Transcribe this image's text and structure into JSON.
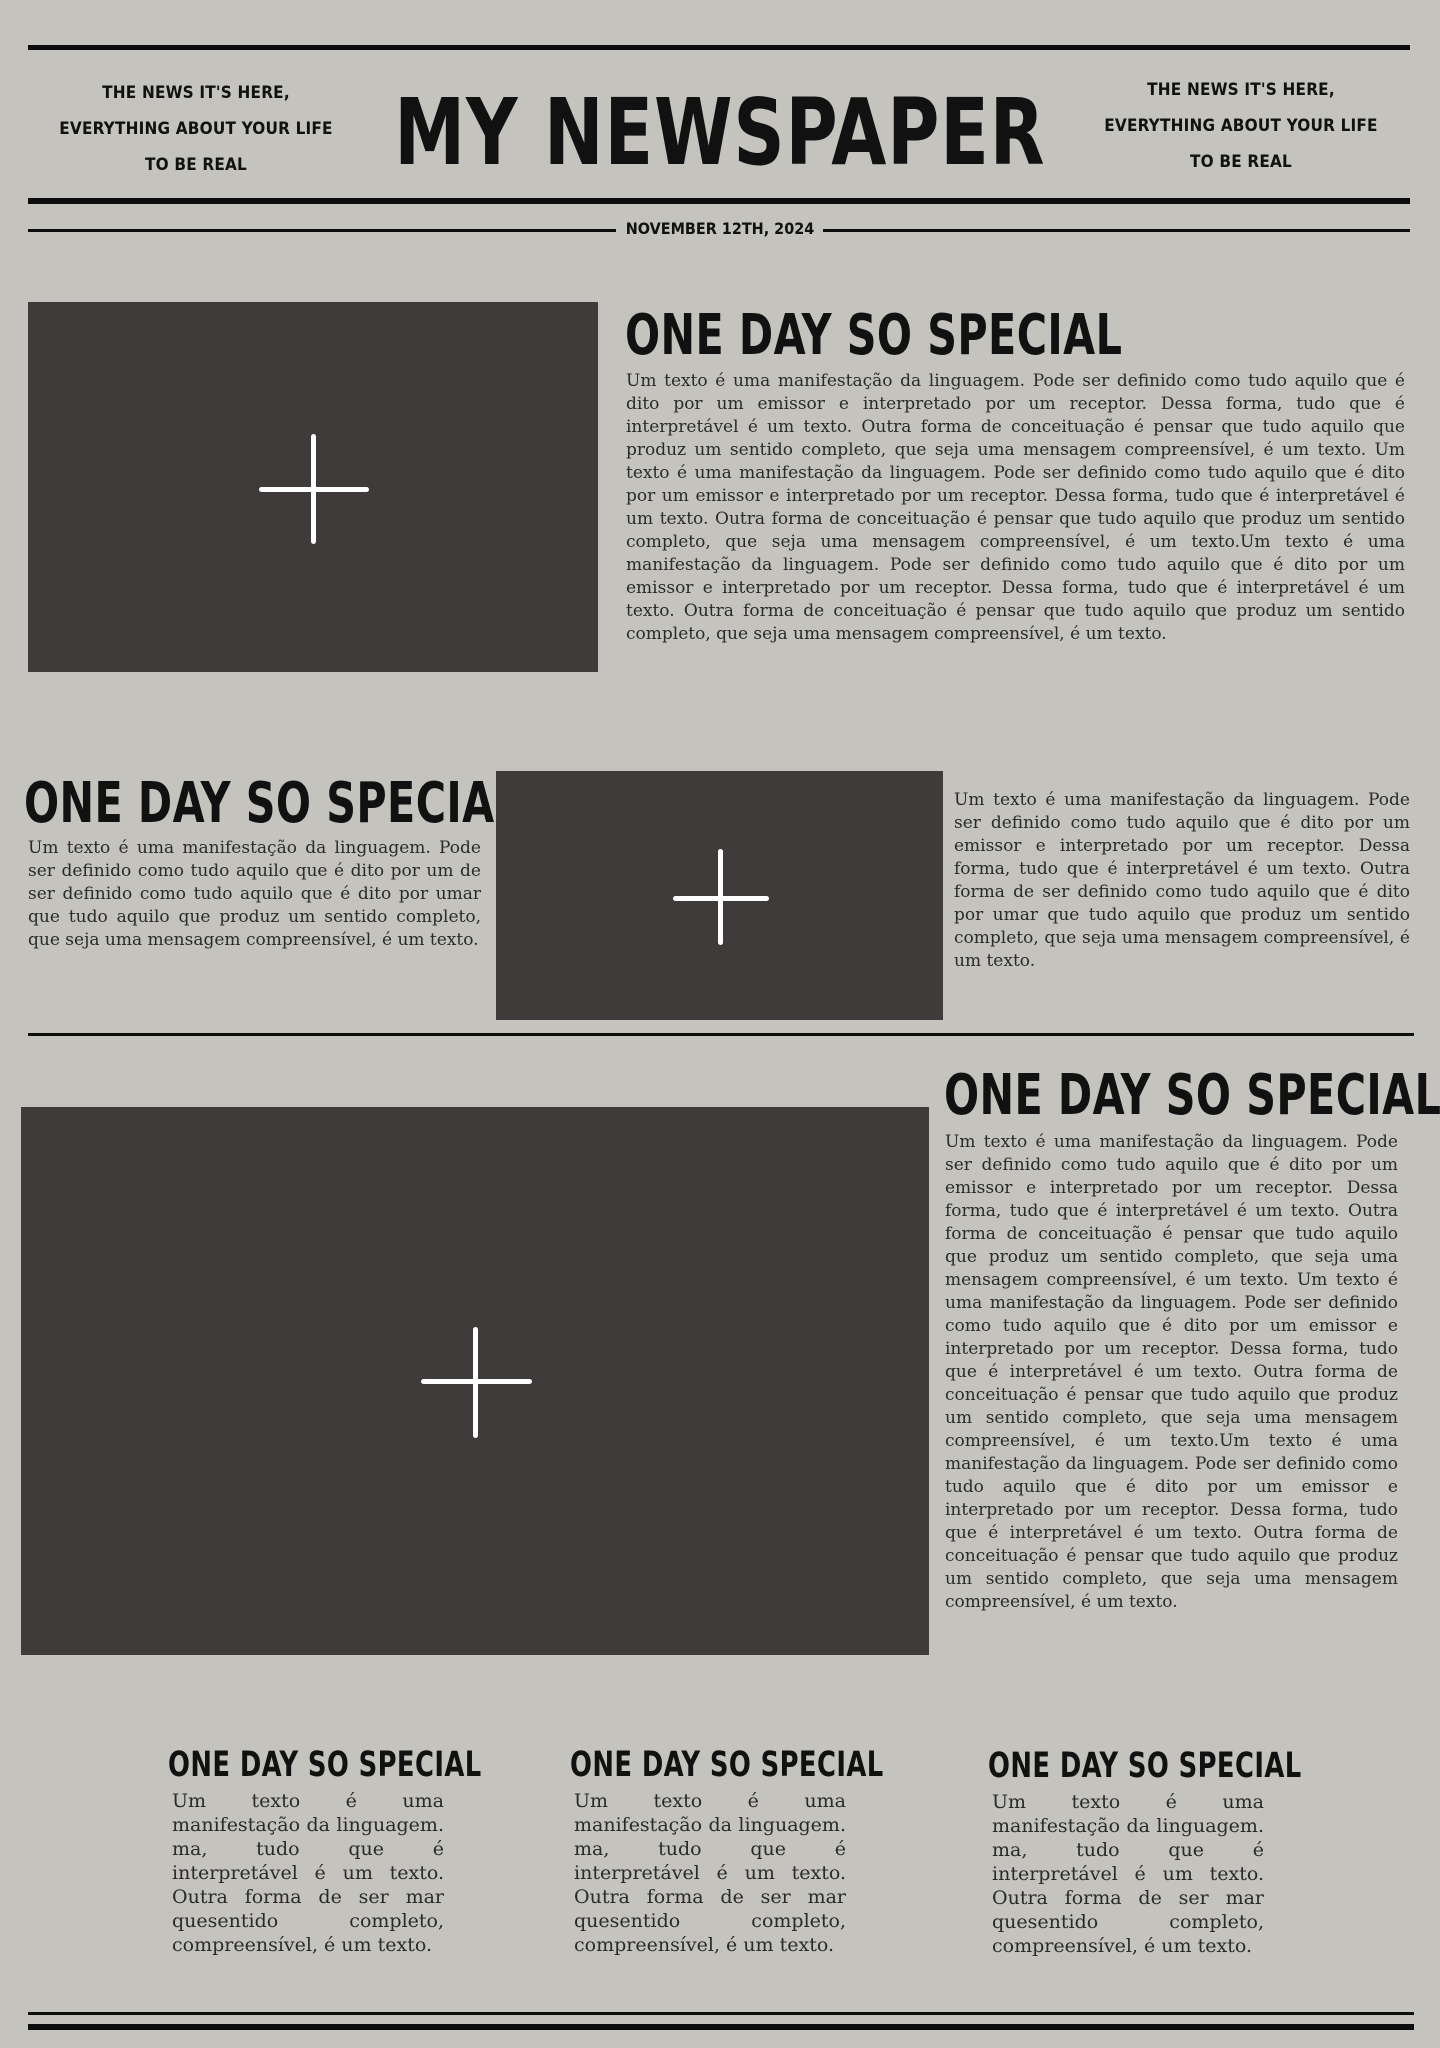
{
  "header": {
    "tagline_left": [
      "THE NEWS IT'S HERE,",
      "EVERYTHING ABOUT YOUR LIFE",
      "TO BE REAL"
    ],
    "tagline_right": [
      "THE NEWS IT'S HERE,",
      "EVERYTHING ABOUT YOUR LIFE",
      "TO BE REAL"
    ],
    "title": "MY NEWSPAPER",
    "date": "NOVEMBER 12TH, 2024"
  },
  "articles": {
    "top": {
      "headline": "ONE DAY SO SPECIAL",
      "body": "Um texto é uma manifestação da linguagem. Pode ser definido como tudo aquilo que é dito por um emissor e interpretado por um receptor. Dessa forma, tudo que é interpretável é um texto. Outra forma de conceituação é pensar que tudo aquilo que produz um sentido completo, que seja uma mensagem compreensível, é um texto. Um texto é uma manifestação da linguagem. Pode ser definido como tudo aquilo que é dito por um emissor e interpretado por um receptor. Dessa forma, tudo que é interpretável é um texto. Outra forma de conceituação é pensar que tudo aquilo que produz um sentido completo, que seja uma mensagem compreensível, é um texto.Um texto é uma manifestação da linguagem. Pode ser definido como tudo aquilo que é dito por um emissor e interpretado por um receptor. Dessa forma, tudo que é interpretável é um texto. Outra forma de conceituação é pensar que tudo aquilo que produz um sentido completo, que seja uma mensagem compreensível, é um texto."
    },
    "middle": {
      "headline": "ONE DAY SO SPECIAL",
      "body_left": "Um texto é uma manifestação da linguagem. Pode ser definido como tudo aquilo que é dito por um de  ser definido como tudo aquilo que é dito por umar que tudo aquilo que produz um sentido completo, que seja uma mensagem compreensível, é um texto.",
      "body_right": "Um texto é uma manifestação da linguagem. Pode ser definido como tudo aquilo que é dito por um emissor e interpretado por um receptor. Dessa forma, tudo que é interpretável é um texto. Outra forma de ser definido como tudo aquilo que é dito por umar que tudo aquilo que produz um sentido completo, que seja uma mensagem compreensível, é um texto."
    },
    "feature": {
      "headline": "ONE DAY SO SPECIAL",
      "body": "Um texto é uma manifestação da linguagem. Pode ser definido como tudo aquilo que é dito por um emissor e interpretado por um receptor. Dessa forma, tudo que é interpretável é um texto. Outra forma de conceituação é pensar que tudo aquilo que produz um sentido completo, que seja uma mensagem compreensível, é um texto. Um texto é uma manifestação da linguagem. Pode ser definido como tudo aquilo que é dito por um emissor e interpretado por um receptor. Dessa forma, tudo que é interpretável é um texto. Outra forma de conceituação é pensar que tudo aquilo que produz um sentido completo, que seja uma mensagem compreensível, é um texto.Um texto é uma manifestação da linguagem. Pode ser definido como tudo aquilo que é dito por um emissor e interpretado por um receptor. Dessa forma, tudo que é interpretável é um texto. Outra forma de conceituação é pensar que tudo aquilo que produz um sentido completo, que seja uma mensagem compreensível, é um texto."
    },
    "columns": [
      {
        "headline": "ONE DAY SO SPECIAL",
        "body": "Um texto é uma manifestação da linguagem. ma, tudo que é interpretável é um texto. Outra forma de  ser mar quesentido completo, compreensível, é um texto."
      },
      {
        "headline": "ONE DAY SO SPECIAL",
        "body": "Um texto é uma manifestação da linguagem. ma, tudo que é interpretável é um texto. Outra forma de  ser mar quesentido completo, compreensível, é um texto."
      },
      {
        "headline": "ONE DAY SO SPECIAL",
        "body": "Um texto é uma manifestação da linguagem. ma, tudo que é interpretável é um texto. Outra forma de  ser mar quesentido completo, compreensível, é um texto."
      }
    ]
  },
  "images": {
    "icon": "plus-icon"
  },
  "colors": {
    "background": "#c4c3be",
    "ink": "#0d0d0d",
    "image_placeholder": "#3f3b3a",
    "plus": "#ffffff"
  }
}
